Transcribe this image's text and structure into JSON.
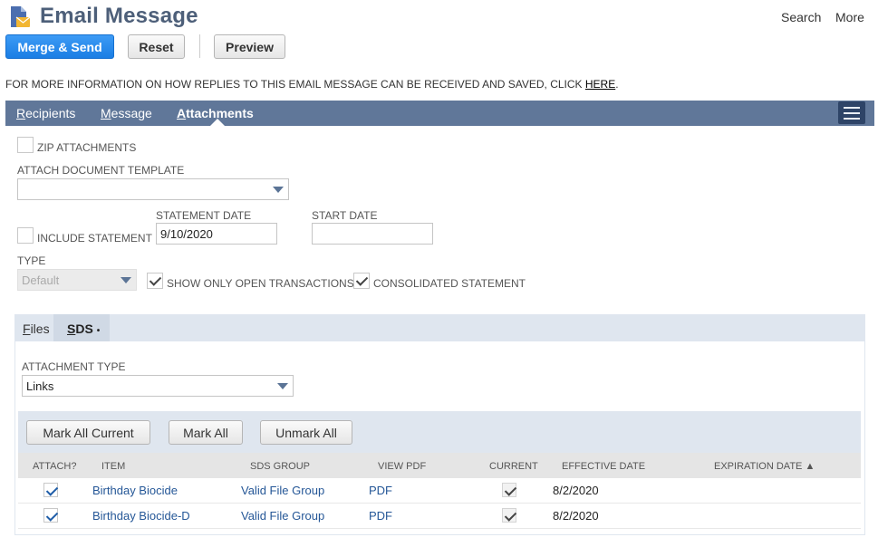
{
  "header": {
    "title": "Email Message",
    "search_label": "Search",
    "more_label": "More"
  },
  "toolbar": {
    "merge_send_label": "Merge & Send",
    "reset_label": "Reset",
    "preview_label": "Preview"
  },
  "info": {
    "text": "FOR MORE INFORMATION ON HOW REPLIES TO THIS EMAIL MESSAGE CAN BE RECEIVED AND SAVED, CLICK ",
    "link_text": "HERE",
    "suffix": "."
  },
  "tabs": [
    {
      "first": "R",
      "rest": "ecipients"
    },
    {
      "first": "M",
      "rest": "essage"
    },
    {
      "first": "A",
      "rest": "ttachments"
    }
  ],
  "attachments": {
    "zip_label": "ZIP ATTACHMENTS",
    "zip_checked": false,
    "doc_template_label": "ATTACH DOCUMENT TEMPLATE",
    "doc_template_value": "",
    "include_statement_label": "INCLUDE STATEMENT",
    "include_statement_checked": false,
    "statement_date_label": "STATEMENT DATE",
    "statement_date_value": "9/10/2020",
    "start_date_label": "START DATE",
    "start_date_value": "",
    "type_label": "TYPE",
    "type_value": "Default",
    "open_tx_label": "SHOW ONLY OPEN TRANSACTIONS",
    "open_tx_checked": true,
    "consolidated_label": "CONSOLIDATED STATEMENT",
    "consolidated_checked": true
  },
  "subtabs": [
    {
      "first": "F",
      "rest": "iles"
    },
    {
      "first": "S",
      "rest": "DS",
      "marker": "•"
    }
  ],
  "sds": {
    "attachment_type_label": "ATTACHMENT TYPE",
    "attachment_type_value": "Links",
    "mark_all_current_label": "Mark All Current",
    "mark_all_label": "Mark All",
    "unmark_all_label": "Unmark All",
    "columns": [
      "ATTACH?",
      "ITEM",
      "SDS GROUP",
      "VIEW PDF",
      "CURRENT",
      "EFFECTIVE DATE",
      "EXPIRATION DATE ▲"
    ],
    "rows": [
      {
        "attach": true,
        "item": "Birthday Biocide",
        "sds_group": "Valid File Group",
        "view_pdf": "PDF",
        "current": true,
        "effective_date": "8/2/2020",
        "expiration_date": ""
      },
      {
        "attach": true,
        "item": "Birthday Biocide-D",
        "sds_group": "Valid File Group",
        "view_pdf": "PDF",
        "current": true,
        "effective_date": "8/2/2020",
        "expiration_date": ""
      }
    ]
  },
  "colors": {
    "title": "#4d5f79",
    "tabbar": "#607799",
    "primary": "#1e87f0",
    "link": "#255797"
  },
  "icons": [
    "email-document-icon",
    "menu-icon",
    "dropdown-arrow-icon",
    "checkmark-icon"
  ]
}
